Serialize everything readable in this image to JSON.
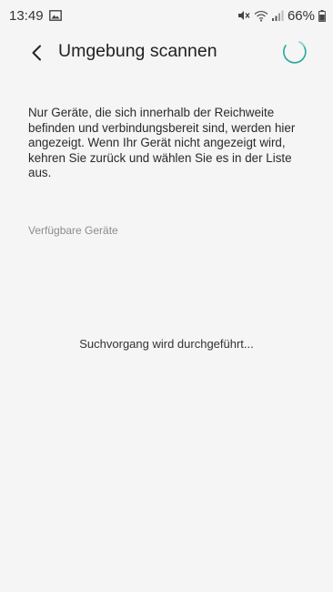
{
  "status_bar": {
    "time": "13:49",
    "battery_percent": "66%",
    "icons": [
      "gallery-notification-icon",
      "mute-icon",
      "wifi-icon",
      "signal-icon",
      "battery-icon"
    ]
  },
  "header": {
    "title": "Umgebung scannen",
    "back_icon": "back-chevron-icon",
    "loading_indicator": "loading-spinner-icon"
  },
  "main": {
    "info_text": "Nur Geräte, die sich innerhalb der Reichweite befinden und verbindungsbereit sind, werden hier angezeigt. Wenn Ihr Gerät nicht angezeigt wird, kehren Sie zurück und wählen Sie es in der Liste aus.",
    "section_label": "Verfügbare Geräte",
    "scanning_status": "Suchvorgang wird durchgeführt..."
  },
  "colors": {
    "background": "#f5f5f5",
    "spinner_accent": "#26a8a0",
    "secondary_text": "#8c8c8c"
  }
}
